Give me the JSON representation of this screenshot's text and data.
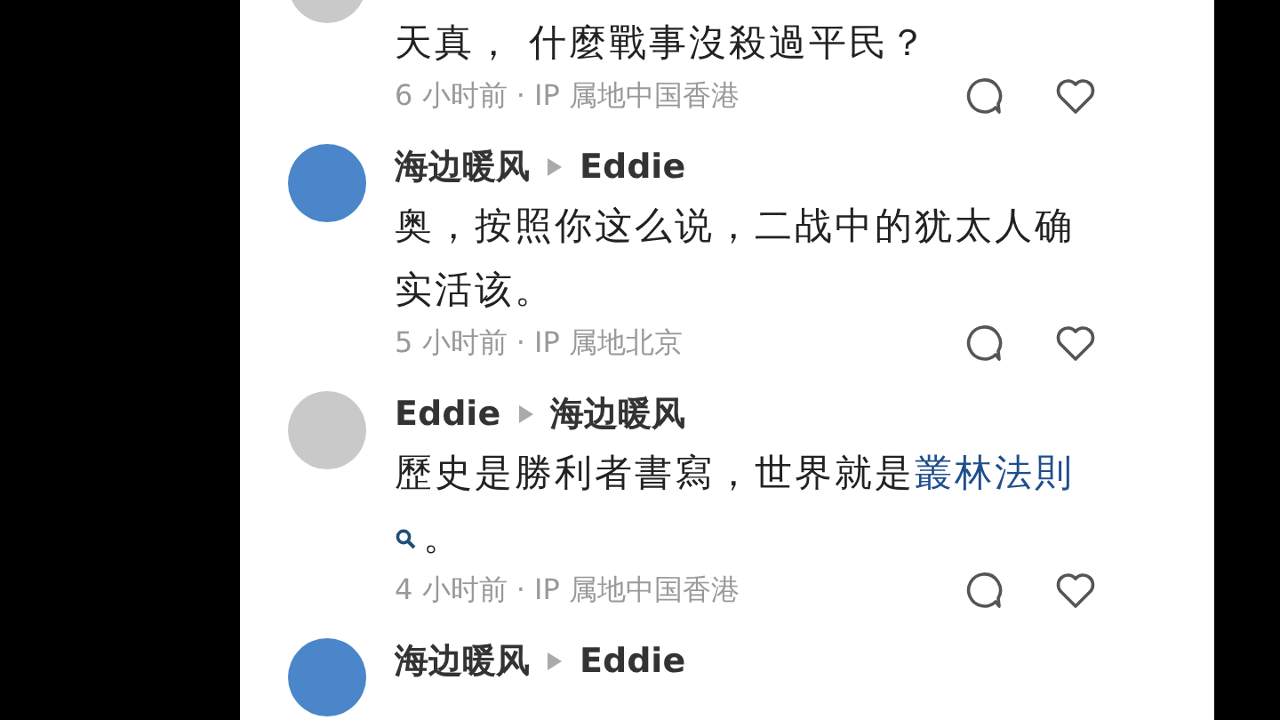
{
  "comments": [
    {
      "color": "#c9c9c9",
      "body": [
        {
          "kind": "text",
          "text": "天真， 什麼戰事沒殺過平民？"
        }
      ],
      "meta": "6 小时前 · IP 属地中国香港"
    },
    {
      "color": "#4a86c9",
      "author": "海边暖风",
      "reply_to": "Eddie",
      "body": [
        {
          "kind": "text",
          "text": "奥，按照你这么说，二战中的犹太人确实活该。"
        }
      ],
      "meta": "5 小时前 · IP 属地北京"
    },
    {
      "color": "#c9c9c9",
      "author": "Eddie",
      "reply_to": "海边暖风",
      "body": [
        {
          "kind": "text",
          "text": "歷史是勝利者書寫，世界就是"
        },
        {
          "kind": "link",
          "text": "叢林法則"
        },
        {
          "kind": "text",
          "text": "。"
        }
      ],
      "meta": "4 小时前 · IP 属地中国香港"
    },
    {
      "color": "#4a86c9",
      "author": "海边暖风",
      "reply_to": "Eddie"
    }
  ]
}
